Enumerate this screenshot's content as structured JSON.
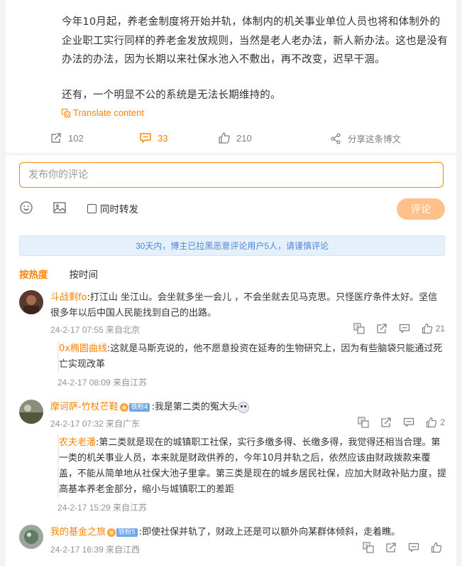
{
  "post": {
    "paragraph1": "今年10月起，养老金制度将开始并轨，体制内的机关事业单位人员也将和体制外的企业职工实行同样的养老金发放规则，当然是老人老办法，新人新办法。这也是没有办法的办法，因为长期以来社保水池入不敷出，再不改变，迟早干涸。",
    "paragraph2": "还有，一个明显不公的系统是无法长期维持的。",
    "translate_label": "Translate content"
  },
  "actions": {
    "repost_count": "102",
    "comment_count": "33",
    "like_count": "210",
    "share_label": "分享这条博文"
  },
  "composer": {
    "placeholder": "发布你的评论",
    "sync_label": "同时转发",
    "submit_label": "评论"
  },
  "notice": "30天内，博主已拉黑恶意评论用户5人，请谨慎评论",
  "sort": {
    "hot": "按热度",
    "time": "按时间"
  },
  "comments": [
    {
      "user": "斗战剩fo",
      "text": ":打江山 坐江山。会坐就多坐一会儿 ，不会坐就去见马克思。只怪医疗条件太好。坚信很多年以后中国人民能找到自己的出路。",
      "meta": "24-2-17 07:55 来自北京",
      "likes": "21",
      "reply": {
        "user": "0x椭圆曲线",
        "text": ":这就是马斯克说的，他不愿意投资在延寿的生物研究上，因为有些脑袋只能通过死亡实现改革",
        "meta": "24-2-17 08:09 来自江苏"
      }
    },
    {
      "user": "摩诃萨-竹杖芒鞋",
      "badge": "铁粉4",
      "text": ":我是第二类的冤大头",
      "meta": "24-2-17 07:32 来自广东",
      "likes": "2",
      "reply": {
        "user": "农夫老潘",
        "text": ":第二类就是现在的城镇职工社保，实行多缴多得、长缴多得，我觉得还相当合理。第一类的机关事业人员，本来就是财政供养的，今年10月并轨之后，依然应该由财政拨款来覆盖，不能从简单地从社保大池子里拿。第三类是现在的城乡居民社保，应加大财政补贴力度，提高基本养老金部分，缩小与城镇职工的差距",
        "meta": "24-2-17 15:29 来自江苏"
      }
    },
    {
      "user": "我的基金之旅",
      "badge": "铁粉5",
      "text": ":即使社保并轨了，财政上还是可以额外向某群体倾斜，走着瞧。",
      "meta": "24-2-17 16:39 来自江西",
      "likes": ""
    }
  ]
}
